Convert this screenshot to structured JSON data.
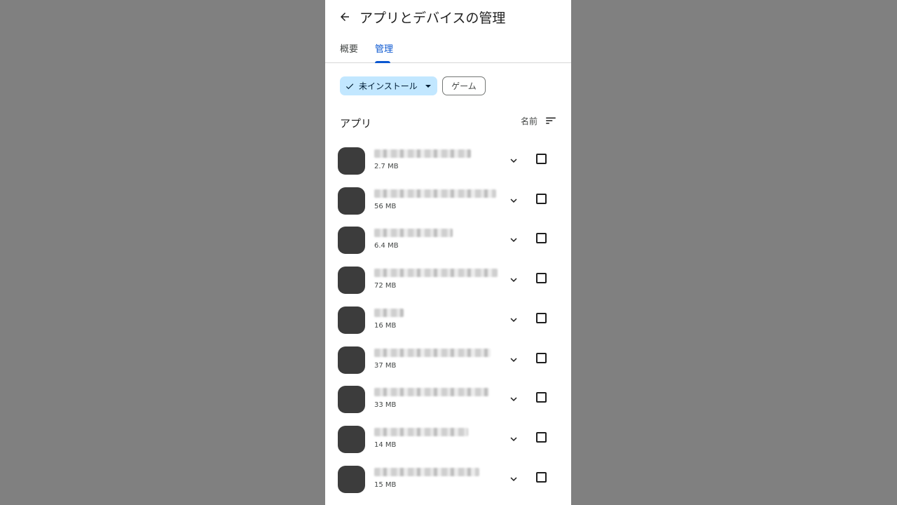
{
  "header": {
    "title": "アプリとデバイスの管理"
  },
  "tabs": [
    {
      "label": "概要",
      "active": false
    },
    {
      "label": "管理",
      "active": true
    }
  ],
  "filters": {
    "status_chip": {
      "label": "未インストール",
      "selected": true
    },
    "game_chip": {
      "label": "ゲーム"
    }
  },
  "section": {
    "title": "アプリ",
    "sort_label": "名前"
  },
  "apps": [
    {
      "size": "2.7 MB",
      "checked": false
    },
    {
      "size": "56 MB",
      "checked": false
    },
    {
      "size": "6.4 MB",
      "checked": false
    },
    {
      "size": "72 MB",
      "checked": false
    },
    {
      "size": "16 MB",
      "checked": false
    },
    {
      "size": "37 MB",
      "checked": false
    },
    {
      "size": "33 MB",
      "checked": false
    },
    {
      "size": "14 MB",
      "checked": false
    },
    {
      "size": "15 MB",
      "checked": false
    }
  ],
  "colors": {
    "accent": "#0b57d0",
    "chip_selected_bg": "#c2e7ff",
    "app_icon_placeholder": "#3c3c3c",
    "backdrop": "#808080"
  },
  "icons": {
    "back": "arrow-back-icon",
    "check": "check-icon",
    "caret": "caret-down-icon",
    "sort": "sort-icon",
    "expand": "chevron-down-icon"
  }
}
